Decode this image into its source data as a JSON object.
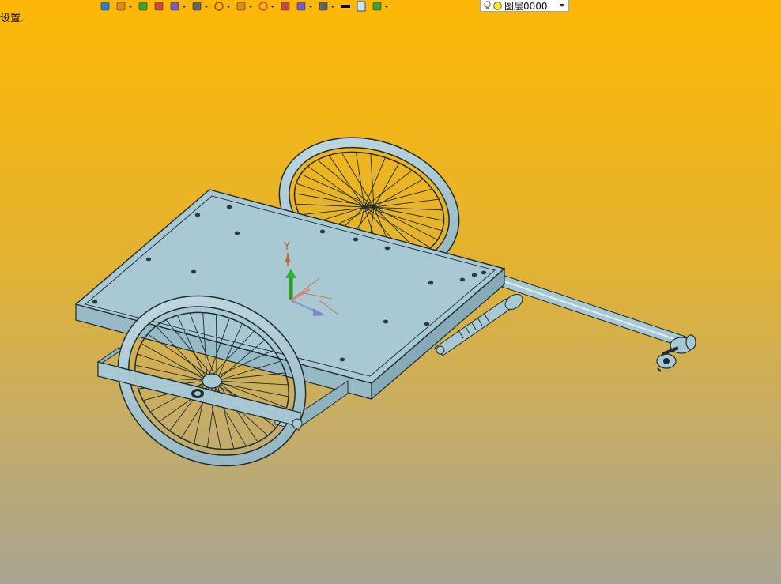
{
  "status": {
    "text": "设置."
  },
  "toolbar": {
    "items": [
      {
        "name": "undo-icon",
        "dropdown": false
      },
      {
        "name": "layer-settings-icon",
        "dropdown": true
      },
      {
        "name": "pencil-icon",
        "dropdown": false
      },
      {
        "name": "box-icon",
        "dropdown": false
      },
      {
        "name": "view-cube-icon",
        "dropdown": true
      },
      {
        "name": "view-orient-icon",
        "dropdown": true
      },
      {
        "name": "wheel-icon",
        "dropdown": true
      },
      {
        "name": "render-style-icon",
        "dropdown": true
      },
      {
        "name": "crosshair-icon",
        "dropdown": true
      },
      {
        "name": "frame-icon",
        "dropdown": false
      },
      {
        "name": "section-icon",
        "dropdown": true
      },
      {
        "name": "cylinder-icon",
        "dropdown": true
      },
      {
        "name": "color-black-icon",
        "dropdown": false
      },
      {
        "name": "page-icon",
        "dropdown": false
      },
      {
        "name": "layer-stack-icon",
        "dropdown": true
      }
    ]
  },
  "layer": {
    "label": "图层0000"
  },
  "triad": {
    "y_label": "Y"
  },
  "colors": {
    "background_top": "#fdb707",
    "background_bottom": "#a8a593",
    "model_fill": "#a8c8d3",
    "model_edge": "#1d2d33"
  }
}
